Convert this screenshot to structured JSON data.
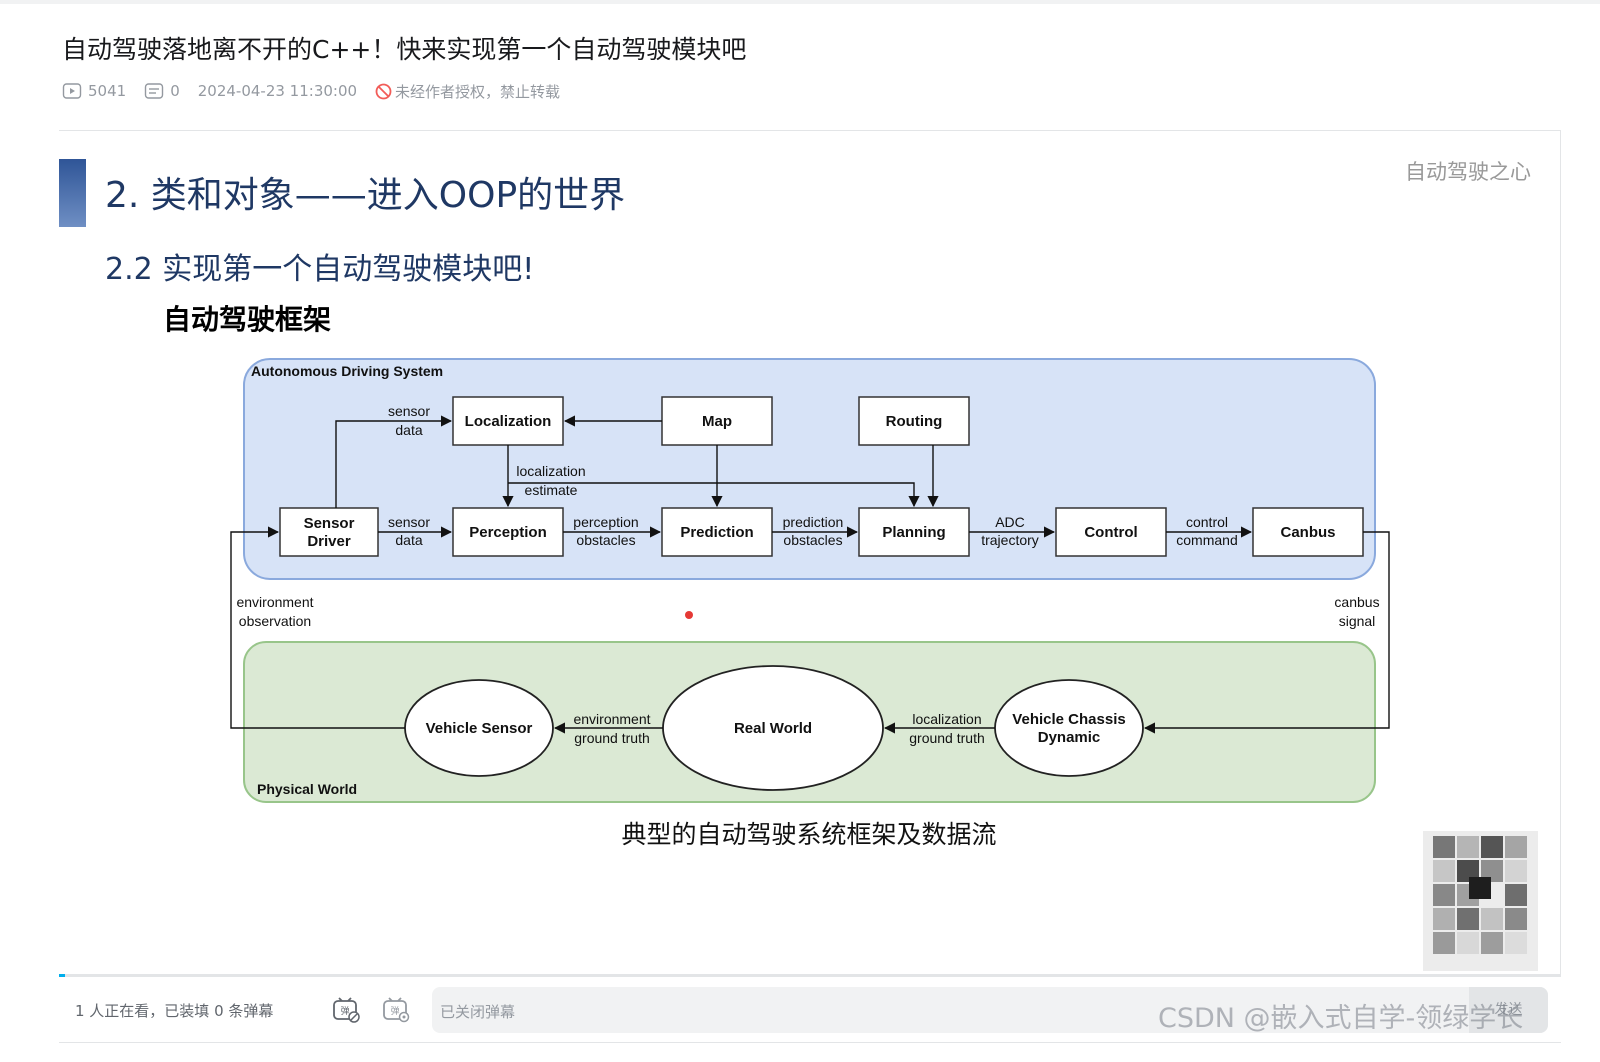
{
  "page": {
    "title": "自动驾驶落地离不开的C++！快来实现第一个自动驾驶模块吧",
    "views": "5041",
    "danmaku_count": "0",
    "datetime": "2024-04-23 11:30:00",
    "copyright_notice": "未经作者授权，禁止转载"
  },
  "slide": {
    "heading": "2. 类和对象——进入OOP的世界",
    "subheading": "2.2 实现第一个自动驾驶模块吧!",
    "section_title": "自动驾驶框架",
    "brand": "自动驾驶之心",
    "caption": "典型的自动驾驶系统框架及数据流",
    "colors": {
      "accent_bar": "#3a66a8",
      "system_fill": "#d7e3f7",
      "system_stroke": "#8aa9dd",
      "physical_fill": "#dbe9d4",
      "physical_stroke": "#98c58a",
      "heading_color": "#1f3864"
    }
  },
  "diagram": {
    "system_label": "Autonomous Driving System",
    "physical_label": "Physical World",
    "nodes": {
      "localization": "Localization",
      "map": "Map",
      "routing": "Routing",
      "sensor_driver_l1": "Sensor",
      "sensor_driver_l2": "Driver",
      "perception": "Perception",
      "prediction": "Prediction",
      "planning": "Planning",
      "control": "Control",
      "canbus": "Canbus",
      "vehicle_sensor": "Vehicle Sensor",
      "real_world": "Real World",
      "vehicle_chassis_l1": "Vehicle Chassis",
      "vehicle_chassis_l2": "Dynamic"
    },
    "edge_labels": {
      "sensor_data_top_l1": "sensor",
      "sensor_data_top_l2": "data",
      "localization_estimate_l1": "localization",
      "localization_estimate_l2": "estimate",
      "sensor_data_l1": "sensor",
      "sensor_data_l2": "data",
      "perception_obstacles_l1": "perception",
      "perception_obstacles_l2": "obstacles",
      "prediction_obstacles_l1": "prediction",
      "prediction_obstacles_l2": "obstacles",
      "adc_trajectory_l1": "ADC",
      "adc_trajectory_l2": "trajectory",
      "control_command_l1": "control",
      "control_command_l2": "command",
      "environment_observation_l1": "environment",
      "environment_observation_l2": "observation",
      "canbus_signal_l1": "canbus",
      "canbus_signal_l2": "signal",
      "env_ground_truth_l1": "environment",
      "env_ground_truth_l2": "ground truth",
      "loc_ground_truth_l1": "localization",
      "loc_ground_truth_l2": "ground truth"
    }
  },
  "controls": {
    "watching": "1 人正在看，已装填 0 条弹幕",
    "danmaku_placeholder": "已关闭弹幕",
    "send": "发送"
  },
  "overlay": {
    "watermark": "CSDN @嵌入式自学-领绿学长"
  }
}
